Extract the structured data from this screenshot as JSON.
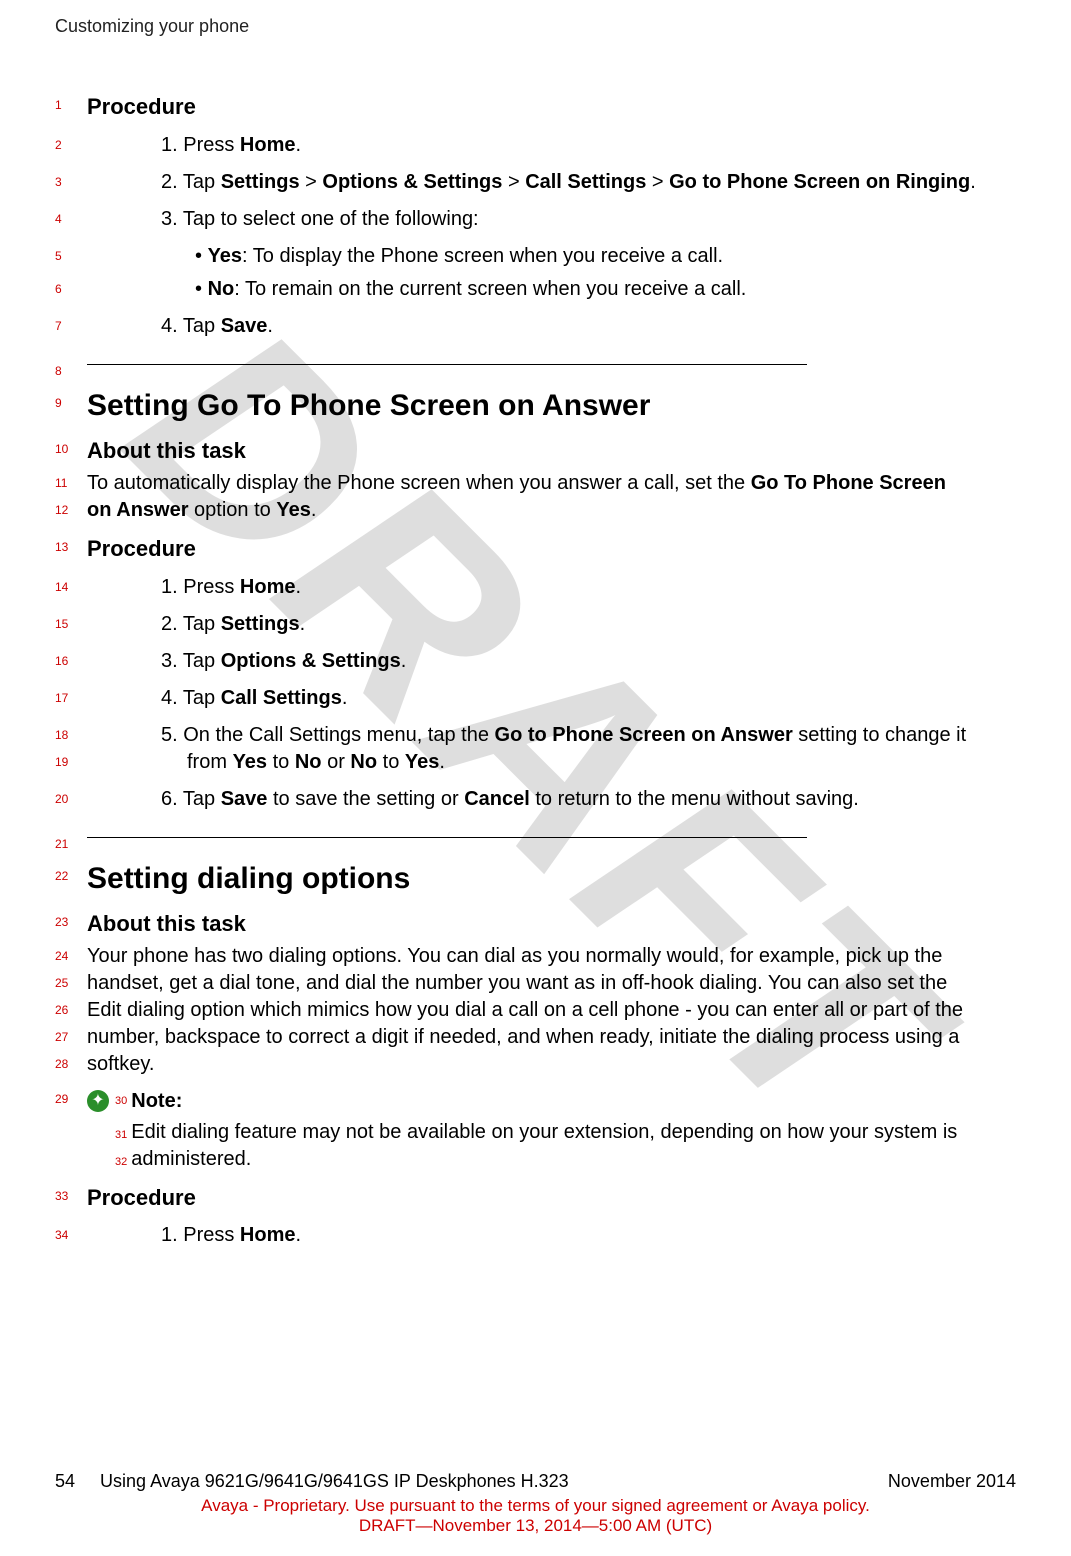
{
  "watermark": "DRAFT",
  "header": "Customizing your phone",
  "lines": {
    "l1": "Procedure",
    "l2_pre": "1.  Press ",
    "l2_b": "Home",
    "l2_post": ".",
    "l3_pre": "2.  Tap ",
    "l3_b1": "Settings",
    "l3_m1": " > ",
    "l3_b2": "Options & Settings",
    "l3_m2": " > ",
    "l3_b3": "Call Settings",
    "l3_m3": " > ",
    "l3_b4": "Go to Phone Screen on Ringing",
    "l3_post": ".",
    "l4": "3.  Tap to select one of the following:",
    "l5_pre": "•  ",
    "l5_b": "Yes",
    "l5_post": ": To display the Phone screen when you receive a call.",
    "l6_pre": "•  ",
    "l6_b": "No",
    "l6_post": ": To remain on the current screen when you receive a call.",
    "l7_pre": "4.  Tap ",
    "l7_b": "Save",
    "l7_post": ".",
    "l9": "Setting Go To Phone Screen on Answer",
    "l10": "About this task",
    "l11_pre": "To automatically display the Phone screen when you answer a call, set the ",
    "l11_b": "Go To Phone Screen",
    "l12_b": "on Answer",
    "l12_mid": " option to ",
    "l12_b2": "Yes",
    "l12_post": ".",
    "l13": "Procedure",
    "l14_pre": "1.  Press ",
    "l14_b": "Home",
    "l14_post": ".",
    "l15_pre": "2.  Tap ",
    "l15_b": "Settings",
    "l15_post": ".",
    "l16_pre": "3.  Tap ",
    "l16_b": "Options & Settings",
    "l16_post": ".",
    "l17_pre": "4.  Tap ",
    "l17_b": "Call Settings",
    "l17_post": ".",
    "l18_pre": "5.  On the Call Settings menu, tap the ",
    "l18_b": "Go to Phone Screen on Answer",
    "l18_post": " setting to change it",
    "l19_pre": "from ",
    "l19_b1": "Yes",
    "l19_m1": " to ",
    "l19_b2": "No",
    "l19_m2": " or ",
    "l19_b3": "No",
    "l19_m3": " to ",
    "l19_b4": "Yes",
    "l19_post": ".",
    "l20_pre": "6.  Tap ",
    "l20_b1": "Save",
    "l20_m": " to save the setting or ",
    "l20_b2": "Cancel",
    "l20_post": " to return to the menu without saving.",
    "l22": "Setting dialing options",
    "l23": "About this task",
    "l24": "Your phone has two dialing options. You can dial as you normally would, for example, pick up the",
    "l25": "handset, get a dial tone, and dial the number you want as in off-hook dialing. You can also set the",
    "l26": "Edit dialing option which mimics how you dial a call on a cell phone - you can enter all or part of the",
    "l27": "number, backspace to correct a digit if needed, and when ready, initiate the dialing process using a",
    "l28": "softkey.",
    "l30": "Note:",
    "l31": "Edit dialing feature may not be available on your extension, depending on how your system is",
    "l32": "administered.",
    "l33": "Procedure",
    "l34_pre": "1.  Press ",
    "l34_b": "Home",
    "l34_post": "."
  },
  "nums": {
    "n1": "1",
    "n2": "2",
    "n3": "3",
    "n4": "4",
    "n5": "5",
    "n6": "6",
    "n7": "7",
    "n8": "8",
    "n9": "9",
    "n10": "10",
    "n11": "11",
    "n12": "12",
    "n13": "13",
    "n14": "14",
    "n15": "15",
    "n16": "16",
    "n17": "17",
    "n18": "18",
    "n19": "19",
    "n20": "20",
    "n21": "21",
    "n22": "22",
    "n23": "23",
    "n24": "24",
    "n25": "25",
    "n26": "26",
    "n27": "27",
    "n28": "28",
    "n29": "29",
    "n30": "30",
    "n31": "31",
    "n32": "32",
    "n33": "33",
    "n34": "34"
  },
  "footer": {
    "page": "54",
    "doc": "Using Avaya 9621G/9641G/9641GS IP Deskphones H.323",
    "date": "November 2014",
    "red1": "Avaya - Proprietary. Use pursuant to the terms of your signed agreement or Avaya policy.",
    "red2": "DRAFT—November 13, 2014—5:00 AM (UTC)"
  },
  "note_icon_glyph": "✦"
}
